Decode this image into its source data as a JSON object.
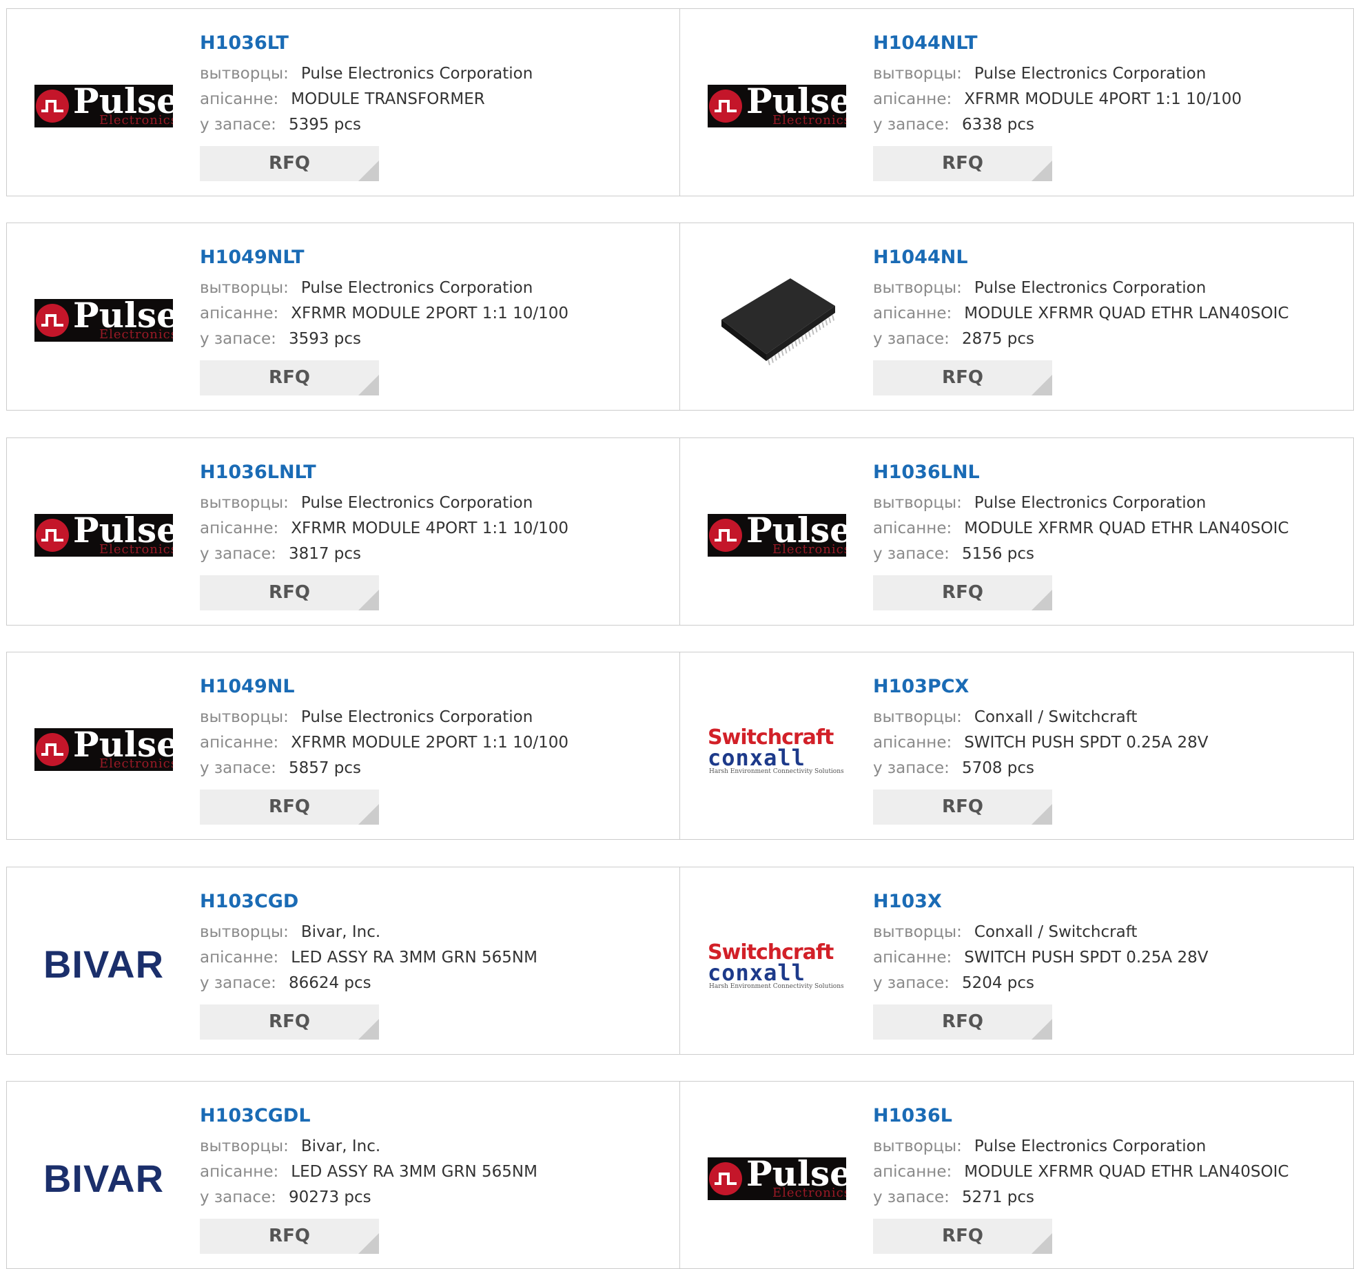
{
  "labels": {
    "manufacturer": "вытворцы:",
    "description": "апісанне:",
    "stock": "у запасе:",
    "rfq": "RFQ",
    "unit": "pcs"
  },
  "logos": {
    "pulse": {
      "word": "Pulse",
      "sub": "Electronics"
    },
    "switchcraft": {
      "top": "Switchcraft",
      "bottom": "conxall",
      "tag": "Harsh Environment Connectivity Solutions"
    },
    "bivar": {
      "word": "BIVAR"
    }
  },
  "colors": {
    "link": "#1a6bb5",
    "pulse_red": "#c4162a",
    "bivar_blue": "#1b2f6b",
    "switchcraft_red": "#d22028",
    "conxall_blue": "#1d3a8a"
  },
  "products": [
    {
      "part": "H1036LT",
      "logo": "pulse",
      "manufacturer": "Pulse Electronics Corporation",
      "description": "MODULE TRANSFORMER",
      "stock": "5395 pcs"
    },
    {
      "part": "H1044NLT",
      "logo": "pulse",
      "manufacturer": "Pulse Electronics Corporation",
      "description": "XFRMR MODULE 4PORT 1:1 10/100",
      "stock": "6338 pcs"
    },
    {
      "part": "H1049NLT",
      "logo": "pulse",
      "manufacturer": "Pulse Electronics Corporation",
      "description": "XFRMR MODULE 2PORT 1:1 10/100",
      "stock": "3593 pcs"
    },
    {
      "part": "H1044NL",
      "logo": "chip",
      "manufacturer": "Pulse Electronics Corporation",
      "description": "MODULE XFRMR QUAD ETHR LAN40SOIC",
      "stock": "2875 pcs"
    },
    {
      "part": "H1036LNLT",
      "logo": "pulse",
      "manufacturer": "Pulse Electronics Corporation",
      "description": "XFRMR MODULE 4PORT 1:1 10/100",
      "stock": "3817 pcs"
    },
    {
      "part": "H1036LNL",
      "logo": "pulse",
      "manufacturer": "Pulse Electronics Corporation",
      "description": "MODULE XFRMR QUAD ETHR LAN40SOIC",
      "stock": "5156 pcs"
    },
    {
      "part": "H1049NL",
      "logo": "pulse",
      "manufacturer": "Pulse Electronics Corporation",
      "description": "XFRMR MODULE 2PORT 1:1 10/100",
      "stock": "5857 pcs"
    },
    {
      "part": "H103PCX",
      "logo": "switchcraft",
      "manufacturer": "Conxall / Switchcraft",
      "description": "SWITCH PUSH SPDT 0.25A 28V",
      "stock": "5708 pcs"
    },
    {
      "part": "H103CGD",
      "logo": "bivar",
      "manufacturer": "Bivar, Inc.",
      "description": "LED ASSY RA 3MM GRN 565NM",
      "stock": "86624 pcs"
    },
    {
      "part": "H103X",
      "logo": "switchcraft",
      "manufacturer": "Conxall / Switchcraft",
      "description": "SWITCH PUSH SPDT 0.25A 28V",
      "stock": "5204 pcs"
    },
    {
      "part": "H103CGDL",
      "logo": "bivar",
      "manufacturer": "Bivar, Inc.",
      "description": "LED ASSY RA 3MM GRN 565NM",
      "stock": "90273 pcs"
    },
    {
      "part": "H1036L",
      "logo": "pulse",
      "manufacturer": "Pulse Electronics Corporation",
      "description": "MODULE XFRMR QUAD ETHR LAN40SOIC",
      "stock": "5271 pcs"
    }
  ]
}
